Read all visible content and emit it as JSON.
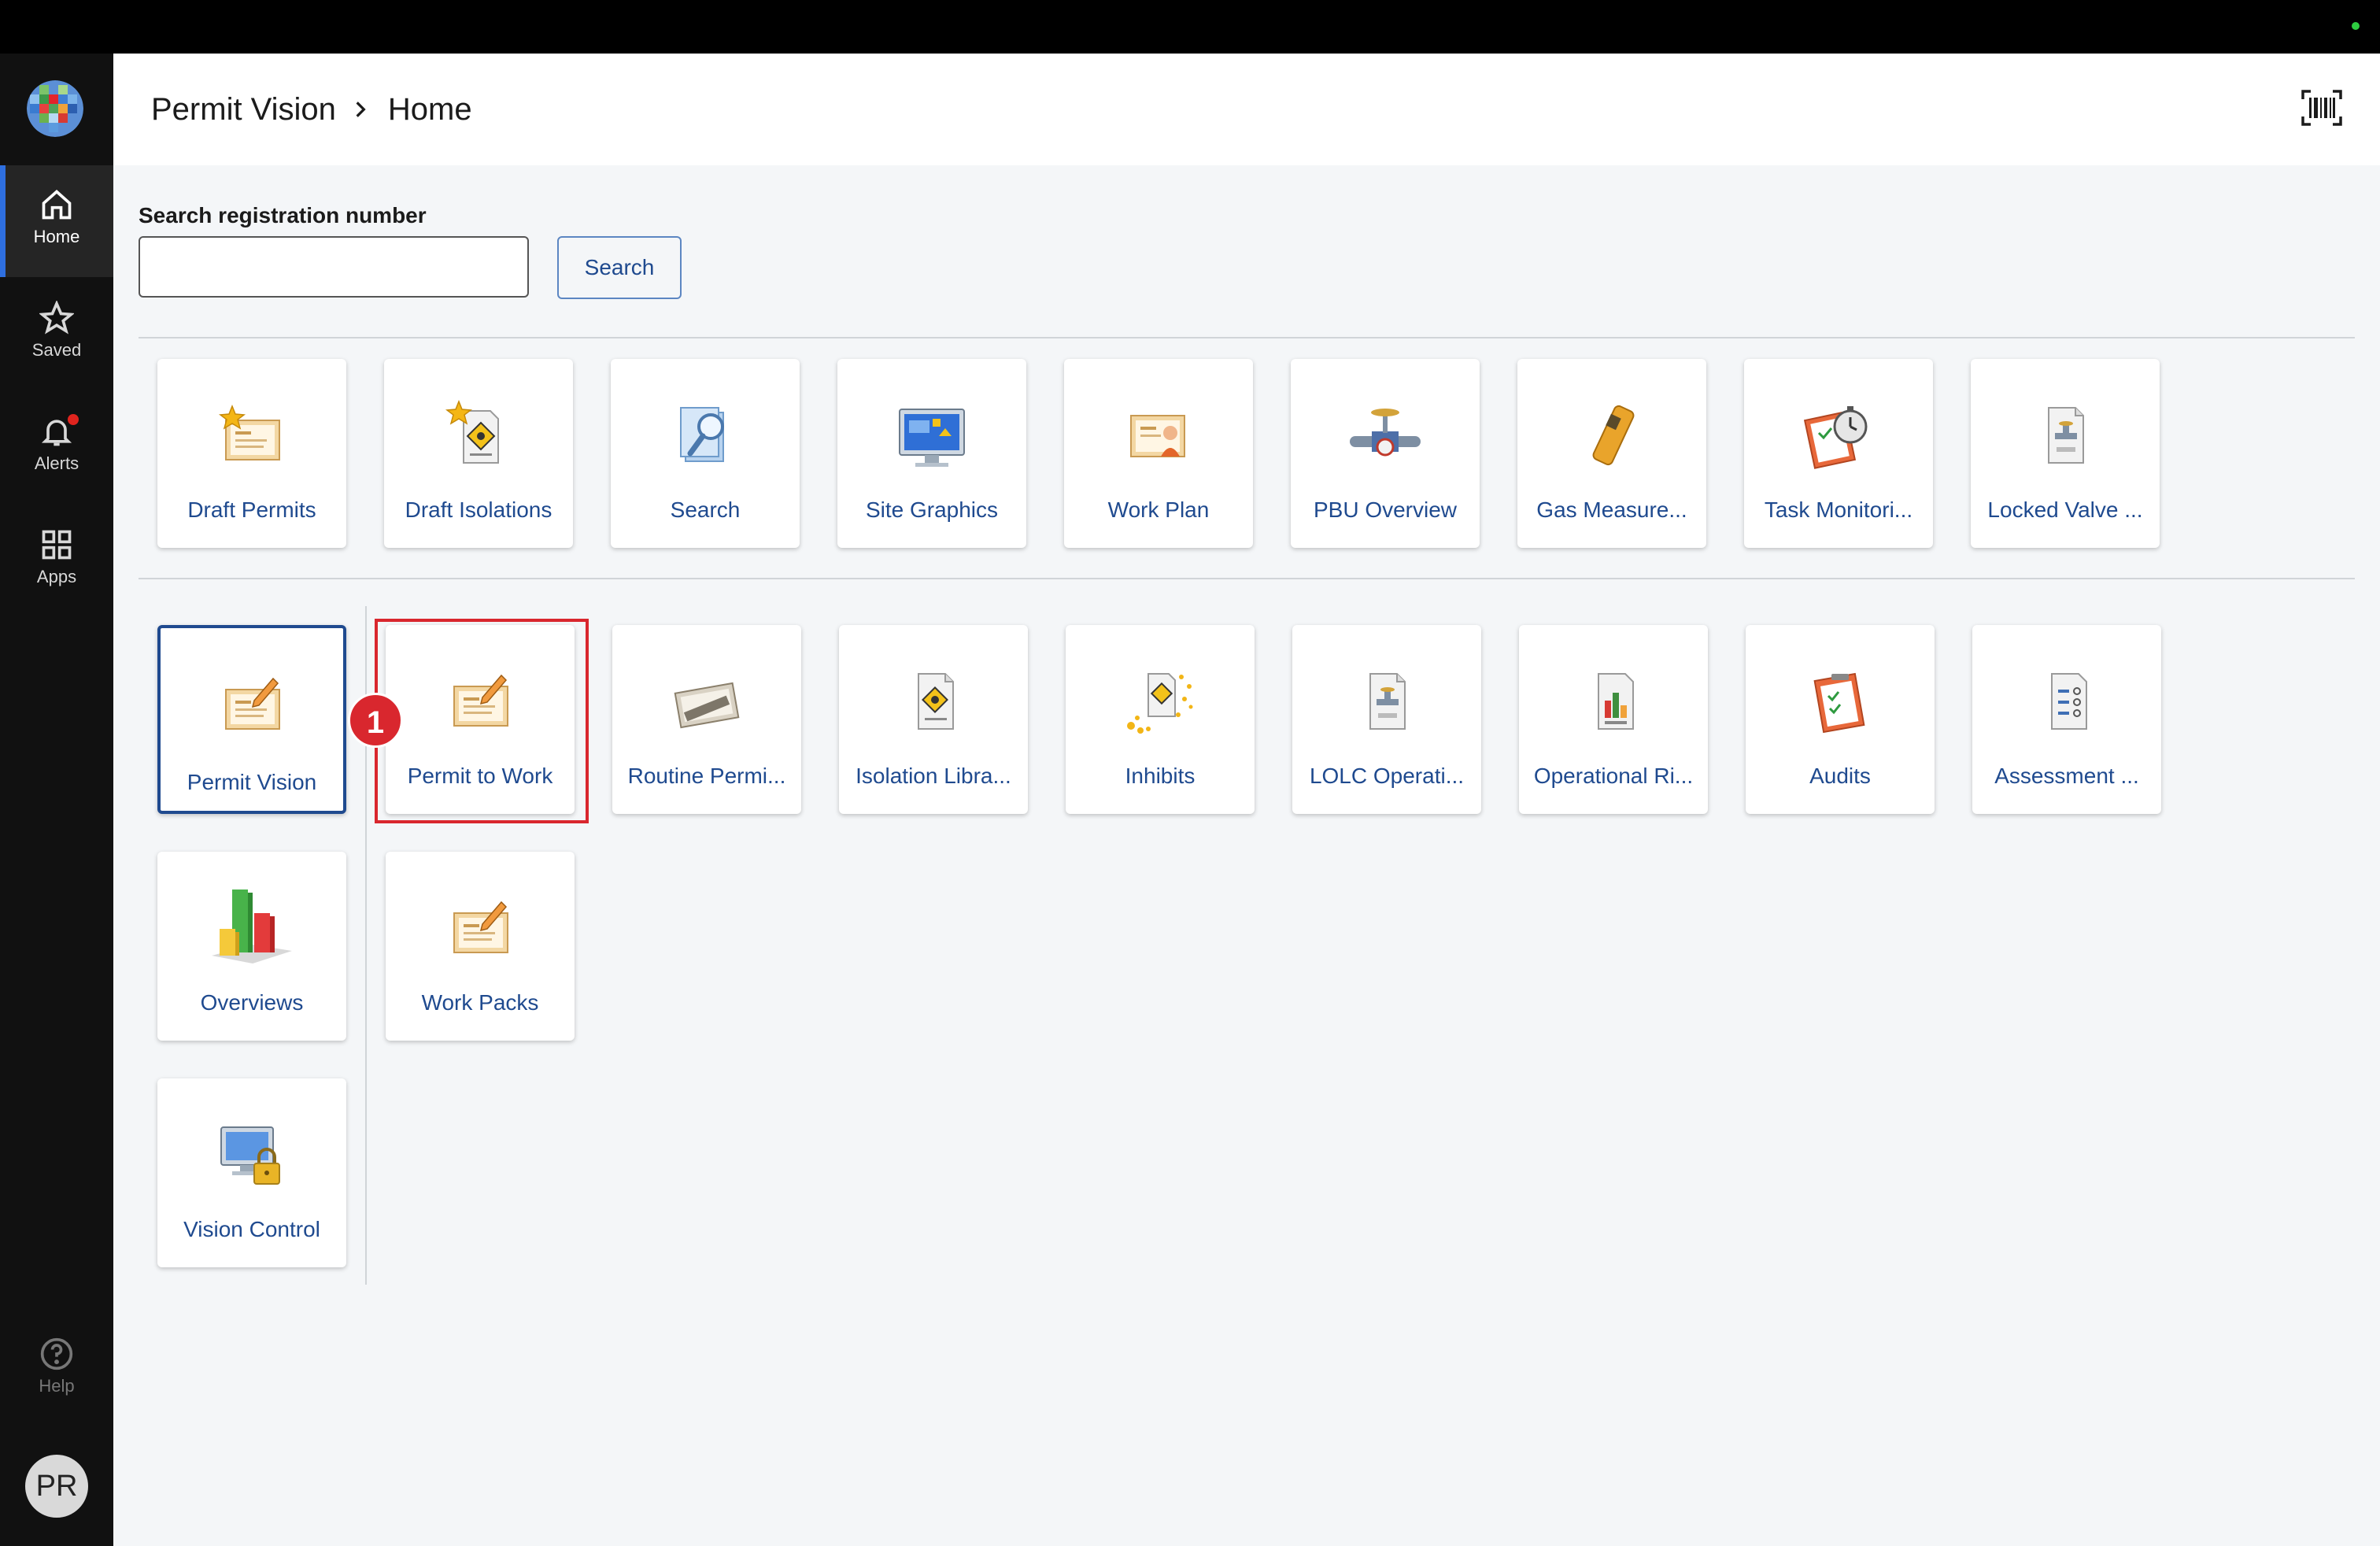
{
  "sidebar": {
    "items": [
      {
        "label": "Home",
        "icon": "home-icon",
        "active": true
      },
      {
        "label": "Saved",
        "icon": "star-icon"
      },
      {
        "label": "Alerts",
        "icon": "bell-icon"
      },
      {
        "label": "Apps",
        "icon": "grid-icon"
      }
    ],
    "help_label": "Help",
    "avatar_initials": "PR"
  },
  "header": {
    "app": "Permit Vision",
    "page": "Home",
    "barcode_icon": "barcode-scan-icon"
  },
  "search": {
    "label": "Search registration number",
    "value": "",
    "button": "Search"
  },
  "favorites": [
    {
      "label": "Draft Permits",
      "icon": "draft-permit-icon"
    },
    {
      "label": "Draft Isolations",
      "icon": "draft-isolation-icon"
    },
    {
      "label": "Search",
      "icon": "search-magnifier-icon"
    },
    {
      "label": "Site Graphics",
      "icon": "monitor-graphics-icon"
    },
    {
      "label": "Work Plan",
      "icon": "work-plan-icon"
    },
    {
      "label": "PBU Overview",
      "icon": "valve-overview-icon"
    },
    {
      "label": "Gas Measure...",
      "icon": "gas-meter-icon"
    },
    {
      "label": "Task Monitori...",
      "icon": "stopwatch-clipboard-icon"
    },
    {
      "label": "Locked Valve ...",
      "icon": "lolc-document-icon"
    }
  ],
  "apps": {
    "permit_vision": {
      "label": "Permit Vision",
      "icon": "permit-vision-icon"
    },
    "permit_to_work": {
      "label": "Permit to Work",
      "icon": "permit-to-work-icon"
    },
    "routine_permits": {
      "label": "Routine Permi...",
      "icon": "routine-permit-icon"
    },
    "isolation_library": {
      "label": "Isolation Libra...",
      "icon": "isolation-document-icon"
    },
    "inhibits": {
      "label": "Inhibits",
      "icon": "inhibits-stars-icon"
    },
    "lolc_operations": {
      "label": "LOLC Operati...",
      "icon": "lolc-operations-icon"
    },
    "operational_risk": {
      "label": "Operational Ri...",
      "icon": "ora-chart-icon"
    },
    "audits": {
      "label": "Audits",
      "icon": "audit-clipboard-icon"
    },
    "assessment": {
      "label": "Assessment ...",
      "icon": "assessment-list-icon"
    },
    "overviews": {
      "label": "Overviews",
      "icon": "bar-chart-icon"
    },
    "work_packs": {
      "label": "Work Packs",
      "icon": "work-pack-icon"
    },
    "vision_control": {
      "label": "Vision Control",
      "icon": "locked-monitor-icon"
    }
  },
  "annotation": {
    "step": "1"
  },
  "colors": {
    "accent": "#1f4a8f",
    "highlight": "#d9272e",
    "sidebar": "#111111"
  }
}
